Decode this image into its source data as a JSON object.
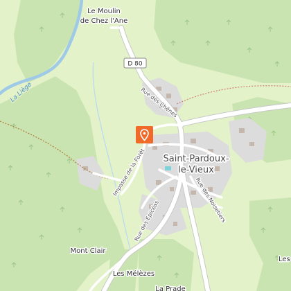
{
  "map": {
    "places": {
      "moulin_line1": "Le Moulin",
      "moulin_line2": "de Chez l'Ane",
      "village_line1": "Saint-Pardoux-",
      "village_line2": "le-Vieux",
      "mont_clair": "Mont Clair",
      "les_melezes": "Les Mélèzes",
      "la_prade": "La Prade",
      "les_edge": "Les"
    },
    "roads": {
      "shield": "D 80",
      "rue_chenes": "Rue des Chênes",
      "impasse_foret": "Impasse de la Forêt",
      "rue_epiceas": "Rue des Epicéas",
      "rue_noisetiers": "Rue des Noisetiers"
    },
    "water": {
      "river": "La Liège"
    },
    "marker": {
      "color": "#f06a2a",
      "icon": "map-pin-icon"
    },
    "colors": {
      "forest": "#c9e4b0",
      "meadow": "#e3f2c9",
      "built_up": "#dcdcdc",
      "road": "#ffffff",
      "river": "#9ecae8"
    }
  }
}
